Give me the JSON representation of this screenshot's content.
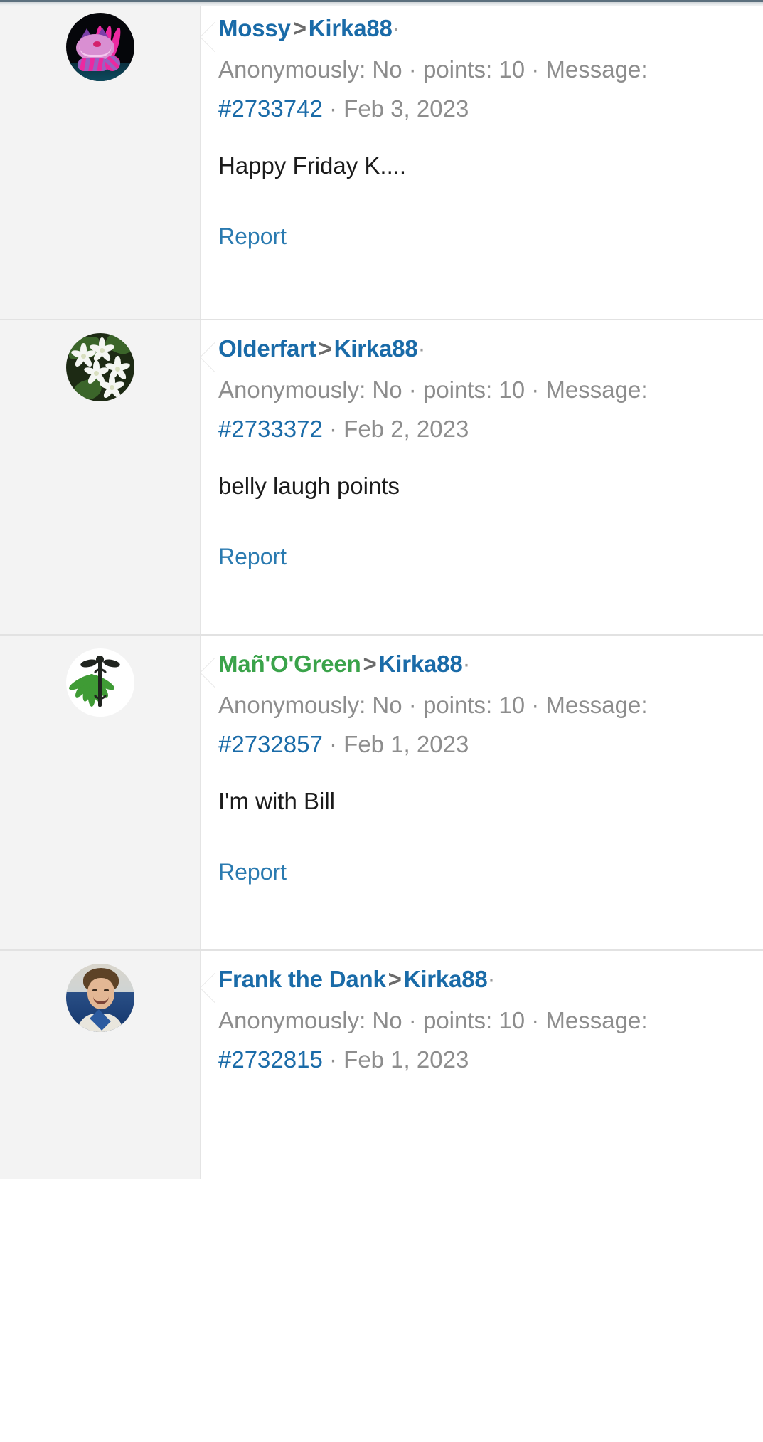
{
  "meta_labels": {
    "anonymously": "Anonymously: No",
    "points": "points: 10",
    "message": "Message:",
    "separator": "·",
    "arrow": ">"
  },
  "colors": {
    "link_blue": "#1a6ba8",
    "report_blue": "#2a7ab0",
    "meta_gray": "#8d8d8d",
    "body_black": "#1b1b1b",
    "green_user": "#3aa34a",
    "avatar_column_bg": "#f3f3f3",
    "content_bg": "#ffffff",
    "divider": "#e2e2e2"
  },
  "entries": [
    {
      "author": "Mossy",
      "author_color": "blue",
      "recipient": "Kirka88",
      "anonymously": "Anonymously: No",
      "points": "points: 10",
      "message_label": "Message:",
      "message_id": "#2733742",
      "date": "Feb 3, 2023",
      "body": "Happy Friday K....",
      "report_label": "Report",
      "avatar": "cheshire-cat-avatar"
    },
    {
      "author": "Olderfart",
      "author_color": "blue",
      "recipient": "Kirka88",
      "anonymously": "Anonymously: No",
      "points": "points: 10",
      "message_label": "Message:",
      "message_id": "#2733372",
      "date": "Feb 2, 2023",
      "body": "belly laugh points",
      "report_label": "Report",
      "avatar": "jasmine-flowers-avatar"
    },
    {
      "author": "Mañ'O'Green",
      "author_color": "green",
      "recipient": "Kirka88",
      "anonymously": "Anonymously: No",
      "points": "points: 10",
      "message_label": "Message:",
      "message_id": "#2732857",
      "date": "Feb 1, 2023",
      "body": "I'm with Bill",
      "report_label": "Report",
      "avatar": "caduceus-cannabis-avatar"
    },
    {
      "author": "Frank the Dank",
      "author_color": "blue",
      "recipient": "Kirka88",
      "anonymously": "Anonymously: No",
      "points": "points: 10",
      "message_label": "Message:",
      "message_id": "#2732815",
      "date": "Feb 1, 2023",
      "body": "",
      "report_label": "",
      "avatar": "frank-portrait-avatar"
    }
  ]
}
